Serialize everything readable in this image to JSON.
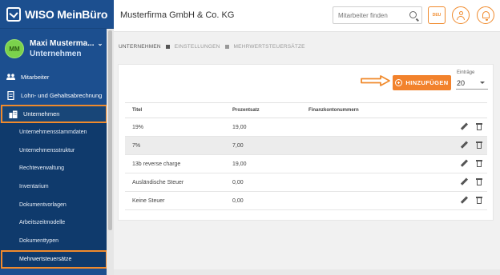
{
  "sidebar": {
    "brand": "WISO MeinBüro",
    "user": {
      "initials": "MM",
      "name": "Maxi Musterma...",
      "section": "Unternehmen"
    },
    "nav": [
      {
        "label": "Mitarbeiter",
        "icon": "people-icon"
      },
      {
        "label": "Lohn- und Gehaltsabrechnung",
        "icon": "document-icon"
      },
      {
        "label": "Unternehmen",
        "icon": "building-icon"
      }
    ],
    "sub_items": [
      {
        "label": "Unternehmensstammdaten"
      },
      {
        "label": "Unternehmensstruktur"
      },
      {
        "label": "Rechteverwaltung"
      },
      {
        "label": "Inventarium"
      },
      {
        "label": "Dokumentvorlagen"
      },
      {
        "label": "Arbeitszeitmodelle"
      },
      {
        "label": "Dokumenttypen"
      },
      {
        "label": "Mehrwertsteuersätze"
      }
    ]
  },
  "header": {
    "company": "Musterfirma GmbH & Co. KG",
    "search_placeholder": "Mitarbeiter finden",
    "language": "DEU"
  },
  "breadcrumb": [
    "UNTERNEHMEN",
    "EINSTELLUNGEN",
    "MEHRWERTSTEUERSÄTZE"
  ],
  "toolbar": {
    "add_label": "HINZUFÜGEN",
    "entries_label": "Einträge",
    "entries_value": "20"
  },
  "table": {
    "columns": [
      "Titel",
      "Prozentsatz",
      "Finanzkontonummern"
    ],
    "rows": [
      {
        "title": "19%",
        "percent": "19,00",
        "account": ""
      },
      {
        "title": "7%",
        "percent": "7,00",
        "account": ""
      },
      {
        "title": "13b reverse charge",
        "percent": "19,00",
        "account": ""
      },
      {
        "title": "Ausländische Steuer",
        "percent": "0,00",
        "account": ""
      },
      {
        "title": "Keine Steuer",
        "percent": "0,00",
        "account": ""
      }
    ]
  },
  "colors": {
    "sidebar": "#1c4f8f",
    "accent": "#f2822c",
    "highlight": "#f08a2c"
  }
}
